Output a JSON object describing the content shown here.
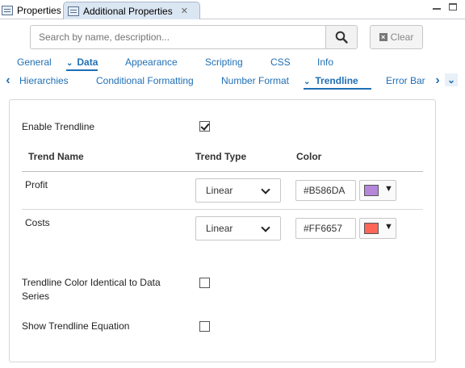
{
  "view_tabs": {
    "properties": "Properties",
    "additional": "Additional Properties",
    "close_glyph": "✕",
    "minimize_icon": "minimize-icon",
    "maximize_icon": "maximize-icon"
  },
  "search": {
    "placeholder": "Search by name, description...",
    "icon": "search-icon",
    "clear_label": "Clear"
  },
  "top_tabs": [
    {
      "label": "General"
    },
    {
      "label": "Data",
      "active": true
    },
    {
      "label": "Appearance"
    },
    {
      "label": "Scripting"
    },
    {
      "label": "CSS"
    },
    {
      "label": "Info"
    }
  ],
  "sub_tabs": [
    {
      "label": "Hierarchies"
    },
    {
      "label": "Conditional Formatting"
    },
    {
      "label": "Number Format"
    },
    {
      "label": "Trendline",
      "active": true
    },
    {
      "label": "Error Bar"
    }
  ],
  "panel": {
    "enable_trendline_label": "Enable Trendline",
    "enable_trendline_checked": true,
    "headers": {
      "trend_name": "Trend Name",
      "trend_type": "Trend Type",
      "color": "Color"
    },
    "rows": [
      {
        "name": "Profit",
        "type": "Linear",
        "hex": "#B586DA",
        "swatch": "#B586DA"
      },
      {
        "name": "Costs",
        "type": "Linear",
        "hex": "#FF6657",
        "swatch": "#FF6657"
      }
    ],
    "identical_color_label": "Trendline Color Identical to Data Series",
    "identical_color_checked": false,
    "show_equation_label": "Show Trendline Equation",
    "show_equation_checked": false
  },
  "colors": {
    "accent": "#1F6FB5"
  }
}
